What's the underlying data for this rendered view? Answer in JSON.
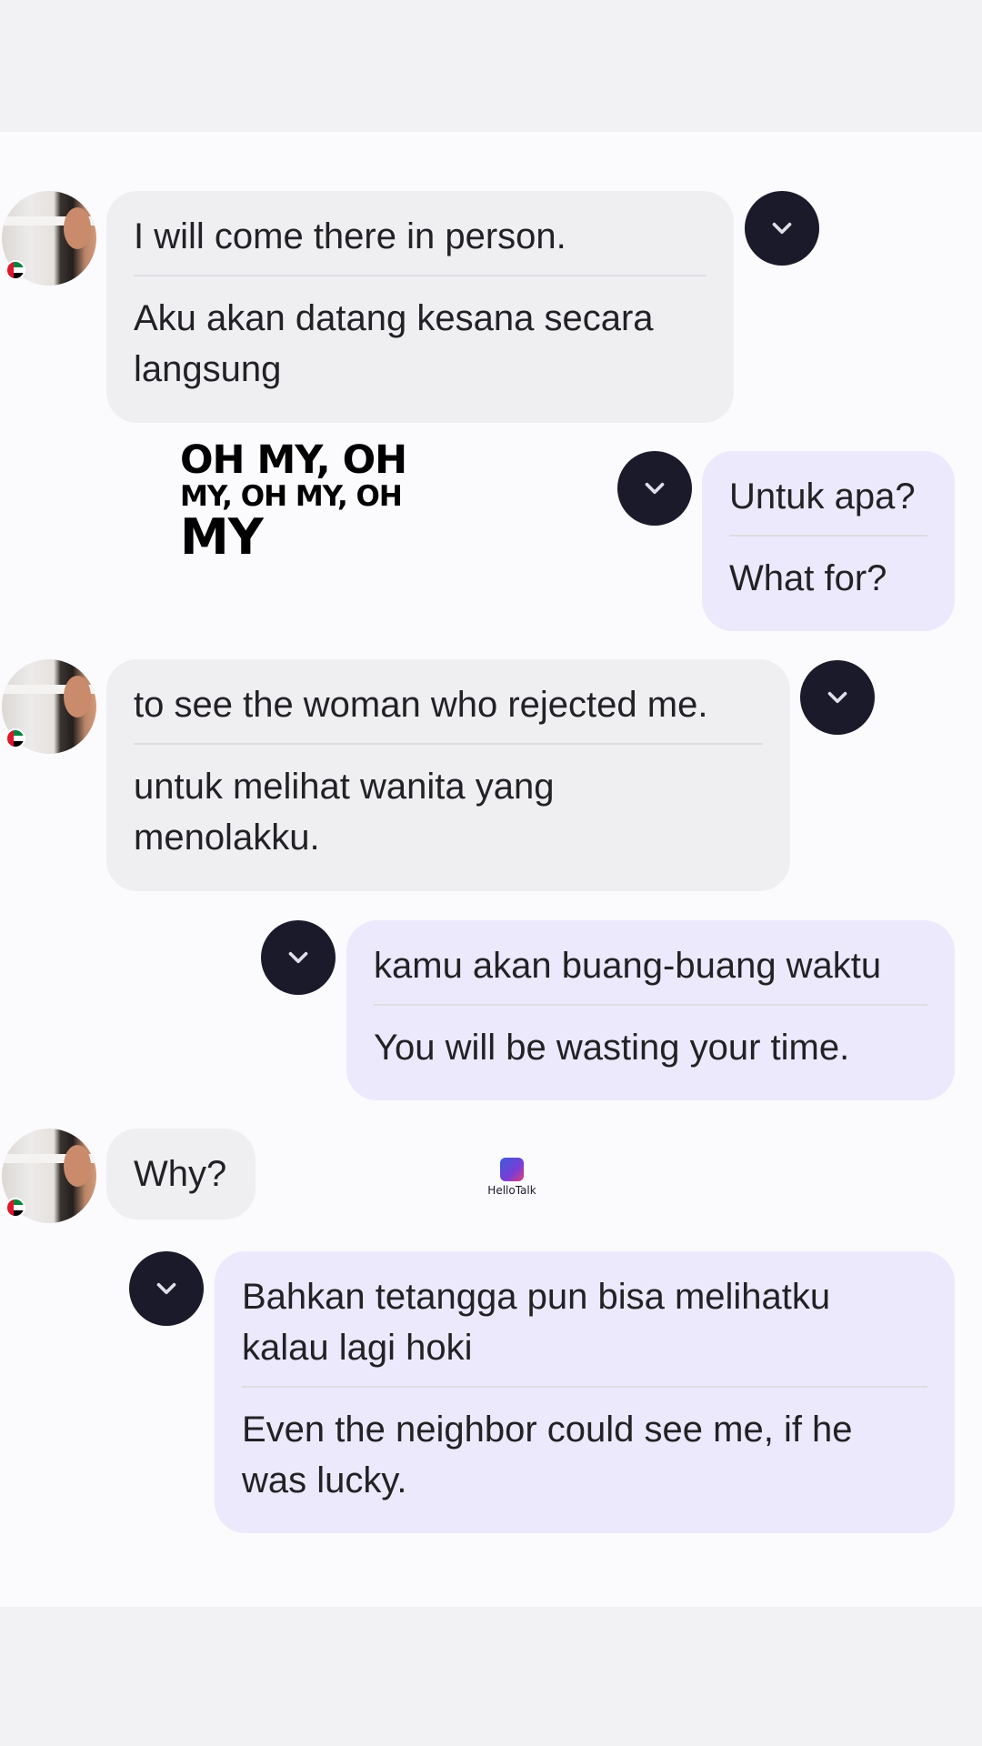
{
  "messages": [
    {
      "side": "in",
      "text": "I will come there in person.",
      "translation_lines": [
        "Aku akan datang kesana secara",
        "langsung"
      ]
    },
    {
      "side": "out",
      "text": "Untuk apa?",
      "translation": "What for?"
    },
    {
      "side": "in",
      "text": "to see the woman who rejected me.",
      "translation_lines": [
        "untuk melihat wanita yang",
        "menolakku."
      ]
    },
    {
      "side": "out",
      "text": "kamu akan buang-buang waktu",
      "translation": "You will be wasting your time."
    },
    {
      "side": "in",
      "text": "Why?"
    },
    {
      "side": "out",
      "text_lines": [
        "Bahkan tetangga pun bisa melihatku",
        "kalau lagi hoki"
      ],
      "translation_lines": [
        "Even the neighbor could see me, if he",
        "was lucky."
      ]
    }
  ],
  "caption": {
    "line1": "OH MY, OH",
    "line2": "MY, OH MY, OH",
    "line3": "MY"
  },
  "watermark": {
    "text": "HelloTalk"
  },
  "icons": {
    "expand": "chevron-down-icon",
    "avatar": "user-avatar",
    "flag": "uae-flag-icon"
  },
  "colors": {
    "incoming_bubble": "#efeef1",
    "outgoing_bubble": "#ece9fc",
    "chevron_button": "#1a1a2b",
    "background": "#fbfafc"
  }
}
